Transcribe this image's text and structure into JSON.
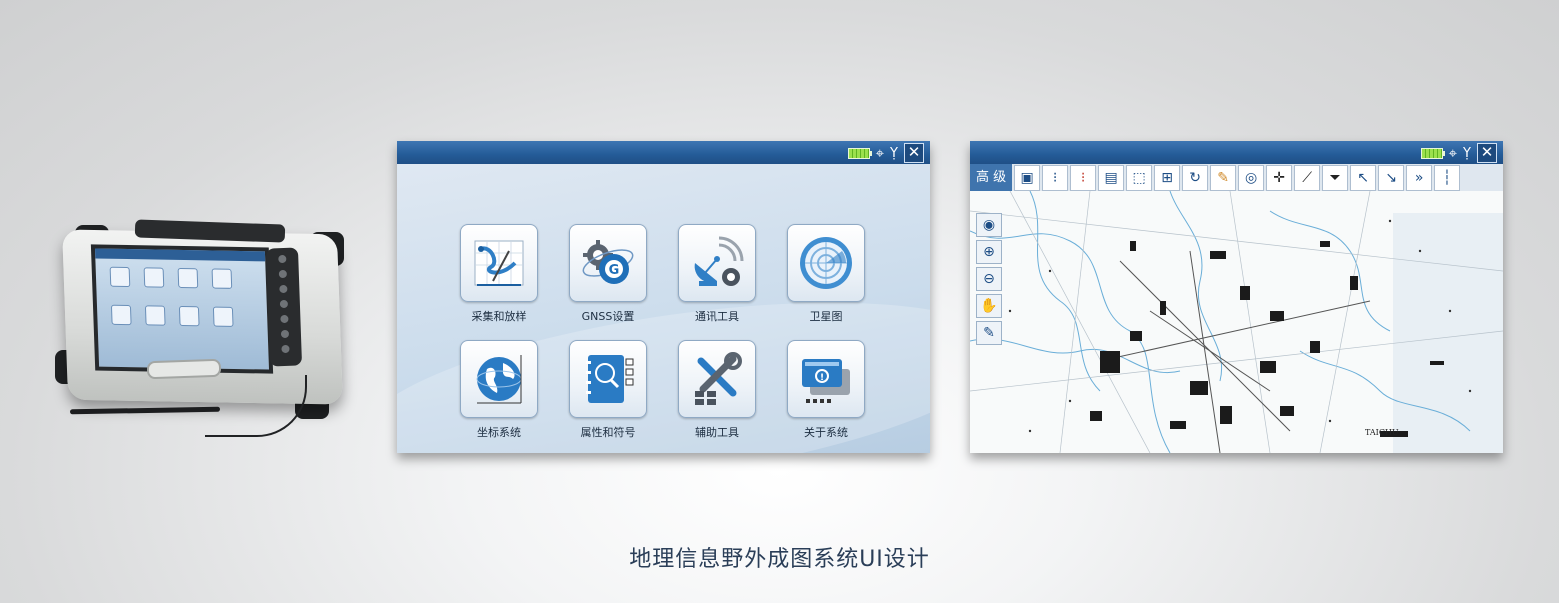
{
  "menu_window": {
    "apps": [
      {
        "label": "采集和放样",
        "icon": "collect-stakeout-icon"
      },
      {
        "label": "GNSS设置",
        "icon": "gnss-settings-icon"
      },
      {
        "label": "通讯工具",
        "icon": "communication-tool-icon"
      },
      {
        "label": "卫星图",
        "icon": "satellite-view-icon"
      },
      {
        "label": "坐标系统",
        "icon": "coordinate-system-icon"
      },
      {
        "label": "属性和符号",
        "icon": "attributes-symbols-icon"
      },
      {
        "label": "辅助工具",
        "icon": "auxiliary-tools-icon"
      },
      {
        "label": "关于系统",
        "icon": "about-system-icon"
      }
    ]
  },
  "map_window": {
    "level_label": "高 级",
    "toolbar_icons": [
      "save-icon",
      "point-grid-icon",
      "point-grid-red-icon",
      "layer-window-icon",
      "select-area-icon",
      "add-box-icon",
      "rotate-icon",
      "palette-icon",
      "target-icon",
      "crosshair-icon",
      "vertex-edit-icon",
      "funnel-icon",
      "arrow-left-icon",
      "arrow-right-icon",
      "double-arrow-icon",
      "ruler-icon"
    ],
    "side_tools": [
      "globe-icon",
      "zoom-in-icon",
      "zoom-out-icon",
      "hand-pan-icon",
      "pen-icon"
    ],
    "map_place_label": "TAICHU"
  },
  "caption": "地理信息野外成图系统UI设计",
  "colors": {
    "titlebar": "#245b97",
    "accent": "#3f74ad",
    "caption": "#2a3e58"
  }
}
